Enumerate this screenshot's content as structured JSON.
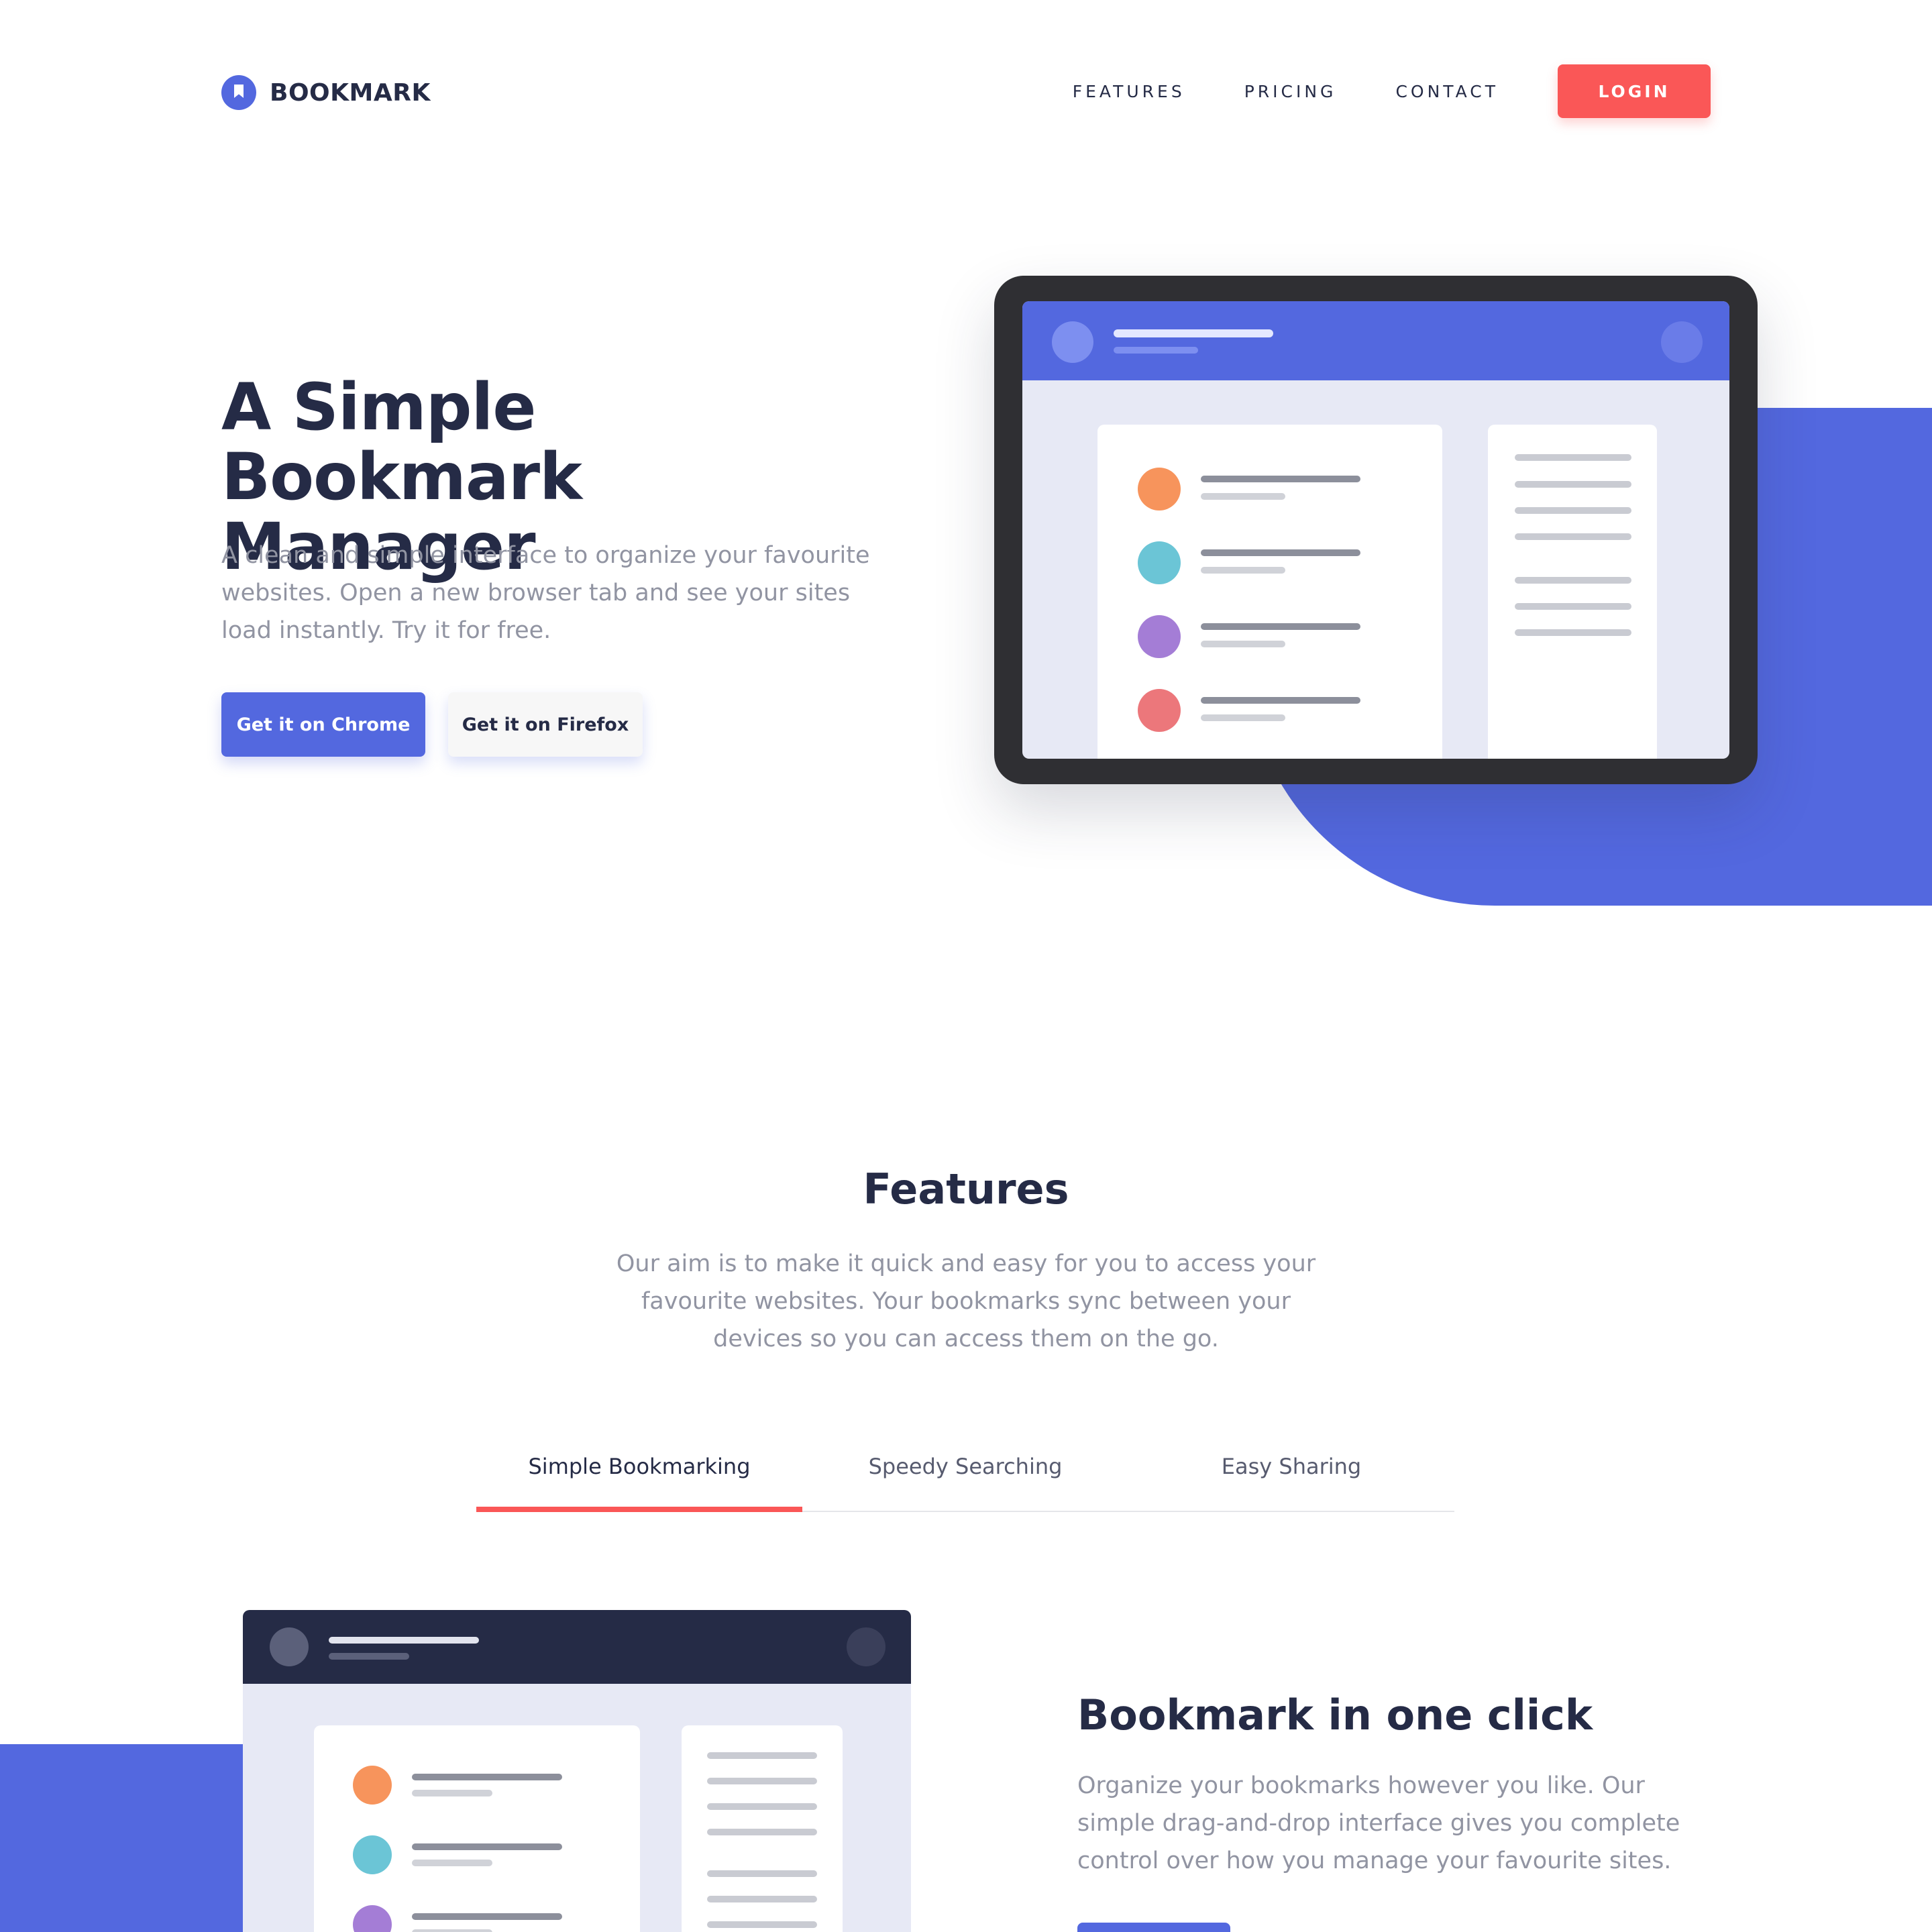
{
  "header": {
    "logo_text": "BOOKMARK",
    "nav": [
      "FEATURES",
      "PRICING",
      "CONTACT"
    ],
    "login_label": "LOGIN"
  },
  "hero": {
    "title": "A Simple Bookmark Manager",
    "text": "A clean and simple interface to organize your favourite websites. Open a new browser tab and see your sites load instantly. Try it for free.",
    "chrome_label": "Get it on Chrome",
    "firefox_label": "Get it on Firefox"
  },
  "features": {
    "title": "Features",
    "text": "Our aim is to make it quick and easy for you to access your favourite websites. Your bookmarks sync between your devices so you can access them on the go.",
    "tabs": [
      {
        "label": "Simple Bookmarking",
        "active": true
      },
      {
        "label": "Speedy Searching",
        "active": false
      },
      {
        "label": "Easy Sharing",
        "active": false
      }
    ],
    "panel": {
      "title": "Bookmark in one click",
      "text": "Organize your bookmarks however you like. Our simple drag-and-drop interface gives you complete control over how you manage your favourite sites."
    }
  },
  "colors": {
    "primary": "#5368df",
    "accent": "#fa5757",
    "dark": "#252b46",
    "bookmark_dots": [
      "#f7945c",
      "#6bc5d6",
      "#a47dd6",
      "#ec777b"
    ]
  },
  "icons": {
    "logo": "bookmark-icon"
  }
}
